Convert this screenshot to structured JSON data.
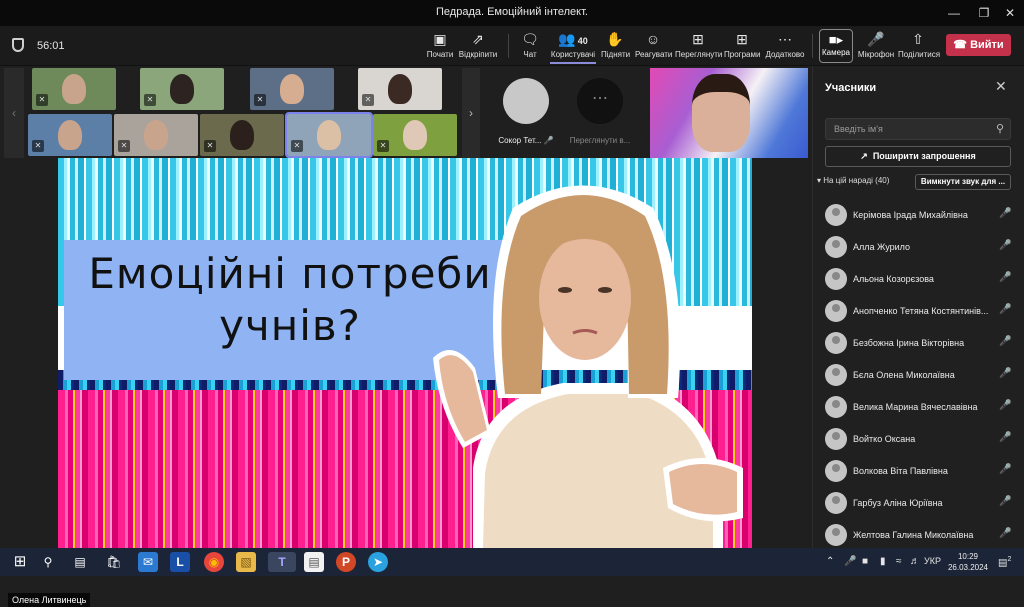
{
  "window": {
    "title": "Педрада. Емоційний інтелект."
  },
  "toolbar": {
    "timer": "56:01",
    "buttons": [
      {
        "label": "Почати",
        "icon": "screen-icon"
      },
      {
        "label": "Відкріпити",
        "icon": "unpin-icon"
      },
      {
        "label": "Чат",
        "icon": "chat-icon"
      },
      {
        "label": "Користувачі",
        "icon": "people-icon",
        "badge": "40"
      },
      {
        "label": "Підняти",
        "icon": "raise-hand-icon"
      },
      {
        "label": "Реагувати",
        "icon": "emoji-icon"
      },
      {
        "label": "Переглянути",
        "icon": "view-icon"
      },
      {
        "label": "Програми",
        "icon": "apps-icon"
      },
      {
        "label": "Додатково",
        "icon": "more-icon"
      }
    ],
    "camera_label": "Камера",
    "mic_label": "Мікрофон",
    "share_label": "Поділитися",
    "leave_label": "Вийти"
  },
  "stage": {
    "tile_avatar_name": "Сокор Тет...",
    "tile_more_label": "Переглянути в...",
    "presenter_name": "Олена Литвинець"
  },
  "slide": {
    "title": "Емоційні потреби учнів?"
  },
  "panel": {
    "title": "Учасники",
    "search_placeholder": "Введіть ім'я",
    "invite_label": "Поширити запрошення",
    "section_label": "На цій нараді (40)",
    "mute_all_label": "Вимкнути звук для ...",
    "participants": [
      {
        "name": "Керімова Ірада Михайлівна",
        "mic": "muted"
      },
      {
        "name": "Алла Журило",
        "mic": "muted"
      },
      {
        "name": "Альона Козорєзова",
        "mic": "muted"
      },
      {
        "name": "Анопченко Тетяна Костянтинів...",
        "mic": "on"
      },
      {
        "name": "Безбожна Ірина Вікторівна",
        "mic": "muted"
      },
      {
        "name": "Бєла Олена Миколаївна",
        "mic": "muted"
      },
      {
        "name": "Велика Марина Вячеславівна",
        "mic": "muted"
      },
      {
        "name": "Войтко Оксана",
        "mic": "muted"
      },
      {
        "name": "Волкова Віта Павлівна",
        "mic": "muted"
      },
      {
        "name": "Гарбуз Аліна Юріївна",
        "mic": "muted"
      },
      {
        "name": "Желтова Галина Миколаївна",
        "mic": "muted"
      }
    ]
  },
  "taskbar": {
    "language": "УКР",
    "time": "10:29",
    "date": "26.03.2024",
    "notifications": "2"
  },
  "colors": {
    "accent": "#7b83eb",
    "leave": "#c4314b",
    "slide_box": "#8fb3f3"
  }
}
